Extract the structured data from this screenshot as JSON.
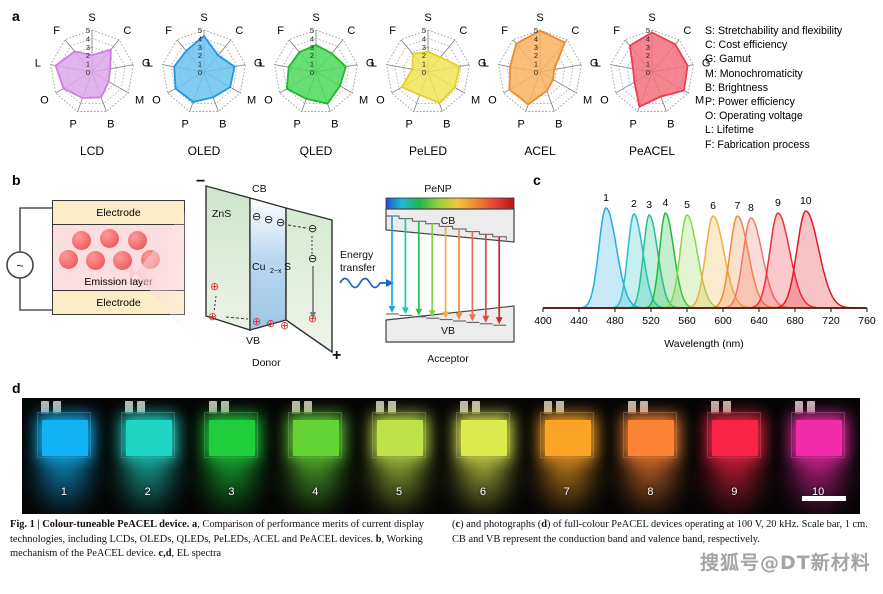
{
  "figure": {
    "panel_labels": {
      "a": "a",
      "b": "b",
      "c": "c",
      "d": "d"
    }
  },
  "panel_a": {
    "axes": [
      "S",
      "C",
      "G",
      "M",
      "B",
      "P",
      "O",
      "L",
      "F"
    ],
    "scale_ticks": [
      "0",
      "1",
      "2",
      "3",
      "4",
      "5"
    ],
    "scale_max": 5,
    "legend": [
      "S: Stretchability and flexibility",
      "C: Cost efficiency",
      "G: Gamut",
      "M: Monochromaticity",
      "B: Brightness",
      "P: Power efficiency",
      "O: Operating voltage",
      "L: Lifetime",
      "F: Fabrication process"
    ],
    "charts": [
      {
        "name": "LCD",
        "color": "#cf7fe0",
        "fill": "#dda7ec",
        "values": [
          2.0,
          3.5,
          2.2,
          2.3,
          3.2,
          3.3,
          3.9,
          4.4,
          3.2
        ]
      },
      {
        "name": "OLED",
        "color": "#2196e3",
        "fill": "#6cc2f0",
        "values": [
          4.3,
          2.6,
          3.7,
          3.6,
          3.2,
          3.8,
          3.9,
          3.6,
          3.3
        ]
      },
      {
        "name": "QLED",
        "color": "#1fb82e",
        "fill": "#4cd95c",
        "values": [
          3.2,
          2.9,
          3.6,
          3.3,
          4.0,
          3.4,
          4.0,
          3.3,
          3.1
        ]
      },
      {
        "name": "PeLED",
        "color": "#e2d024",
        "fill": "#f0e558",
        "values": [
          2.4,
          2.3,
          3.8,
          3.7,
          3.9,
          2.9,
          3.6,
          1.9,
          2.8
        ]
      },
      {
        "name": "ACEL",
        "color": "#f08a2c",
        "fill": "#f9b363",
        "values": [
          4.9,
          4.6,
          1.7,
          1.8,
          2.4,
          4.1,
          4.2,
          3.6,
          4.4
        ]
      },
      {
        "name": "PeACEL",
        "color": "#ee3b4e",
        "fill": "#f4707f",
        "values": [
          4.7,
          4.3,
          4.3,
          4.4,
          3.1,
          4.4,
          2.4,
          2.3,
          4.1
        ]
      }
    ]
  },
  "panel_b": {
    "device": {
      "electrode_top": "Electrode",
      "electrode_bottom": "Electrode",
      "emission_layer": "Emission layer",
      "source_symbol": "~"
    },
    "band_diagram": {
      "minus_sign": "−",
      "plus_sign": "+",
      "cb_label": "CB",
      "vb_label": "VB",
      "zns_label": "ZnS",
      "cu2xs_label": "Cu",
      "cu2xs_sub": "2−x",
      "cu2xs_tail": "S",
      "donor_label": "Donor",
      "acceptor_label": "Acceptor",
      "penp_label": "PeNP",
      "energy_transfer_label_line1": "Energy",
      "energy_transfer_label_line2": "transfer",
      "electron_symbol": "⊖",
      "hole_symbol": "⊕"
    },
    "transfer_arrow_colors": [
      "#18a8e0",
      "#1fc8b4",
      "#21c34a",
      "#7fd24a",
      "#f0ae3c",
      "#ee8b3a",
      "#ef6a52",
      "#e3483f",
      "#cf2227"
    ]
  },
  "chart_data": {
    "type": "line",
    "title": "",
    "xlabel": "Wavelength (nm)",
    "ylabel": "",
    "xlim": [
      400,
      760
    ],
    "xticks": [
      400,
      440,
      480,
      520,
      560,
      600,
      640,
      680,
      720,
      760
    ],
    "grid": false,
    "legend_position": "above-peaks",
    "peak_labels": [
      "1",
      "2",
      "3",
      "4",
      "5",
      "6",
      "7",
      "8",
      "9",
      "10"
    ],
    "series": [
      {
        "name": "1",
        "peak_nm": 470,
        "fwhm_nm": 26,
        "height": 1.0,
        "color": "#29a9e0"
      },
      {
        "name": "2",
        "peak_nm": 501,
        "fwhm_nm": 22,
        "height": 0.94,
        "color": "#26c2c0"
      },
      {
        "name": "3",
        "peak_nm": 518,
        "fwhm_nm": 21,
        "height": 0.93,
        "color": "#24c293"
      },
      {
        "name": "4",
        "peak_nm": 536,
        "fwhm_nm": 21,
        "height": 0.95,
        "color": "#22bc3c"
      },
      {
        "name": "5",
        "peak_nm": 560,
        "fwhm_nm": 25,
        "height": 0.93,
        "color": "#8fd44f"
      },
      {
        "name": "6",
        "peak_nm": 589,
        "fwhm_nm": 27,
        "height": 0.92,
        "color": "#f0b03c"
      },
      {
        "name": "7",
        "peak_nm": 616,
        "fwhm_nm": 27,
        "height": 0.92,
        "color": "#f08a3c"
      },
      {
        "name": "8",
        "peak_nm": 631,
        "fwhm_nm": 28,
        "height": 0.9,
        "color": "#f0776e"
      },
      {
        "name": "9",
        "peak_nm": 661,
        "fwhm_nm": 29,
        "height": 0.95,
        "color": "#ee2f3a"
      },
      {
        "name": "10",
        "peak_nm": 692,
        "fwhm_nm": 32,
        "height": 0.97,
        "color": "#e01b24"
      }
    ]
  },
  "panel_d": {
    "device_numbers": [
      "1",
      "2",
      "3",
      "4",
      "5",
      "6",
      "7",
      "8",
      "9",
      "10"
    ],
    "device_colors": [
      "#12b3f5",
      "#1fd6c4",
      "#1fce3c",
      "#63d336",
      "#bfe14a",
      "#ddea4e",
      "#fba325",
      "#fb8333",
      "#f82546",
      "#f22ba8"
    ],
    "scale_bar_label": "1 cm"
  },
  "caption": {
    "left_html": "<b>Fig. 1 | Colour-tuneable PeACEL device. a</b>, Comparison of performance merits of current display technologies, including LCDs, OLEDs, QLEDs, PeLEDs, ACEL and PeACEL devices. <b>b</b>, Working mechanism of the PeACEL device. <b>c,d</b>, EL spectra",
    "right_html": "(<b>c</b>) and photographs (<b>d</b>) of full-colour PeACEL devices operating at 100 V, 20 kHz. Scale bar, 1 cm. CB and VB represent the conduction band and valence band, respectively."
  },
  "watermark": {
    "text": "搜狐号@DT新材料"
  }
}
